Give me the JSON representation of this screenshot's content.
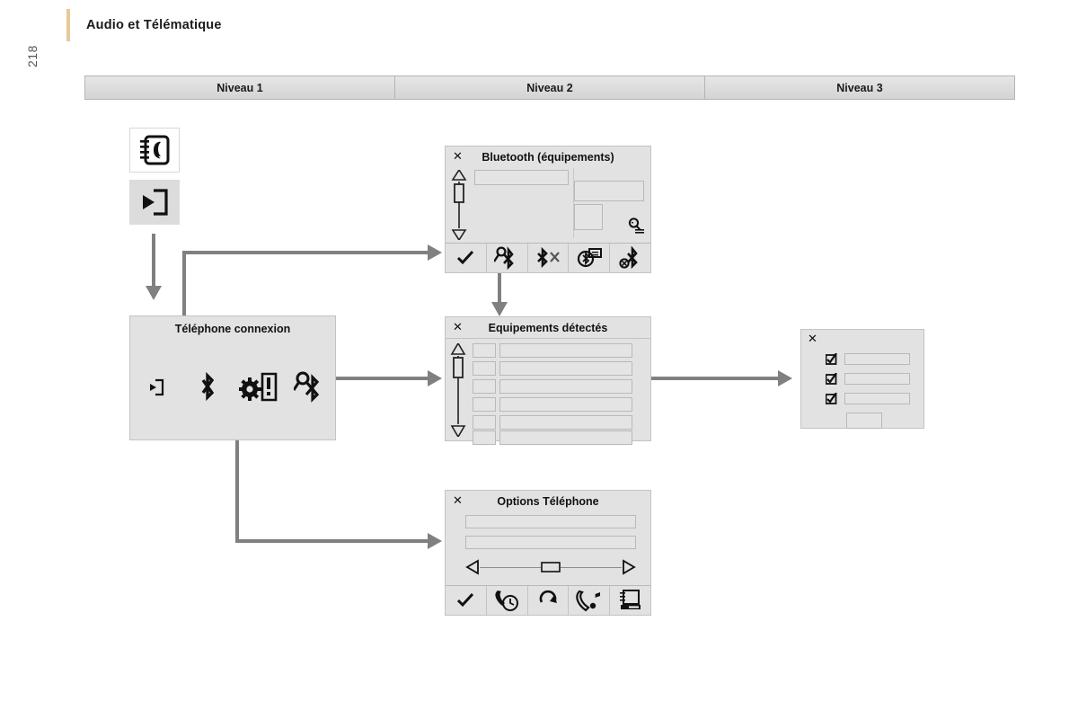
{
  "document": {
    "title": "Audio et Télématique",
    "page_number": "218"
  },
  "levels": {
    "columns": [
      {
        "label": "Niveau 1"
      },
      {
        "label": "Niveau 2"
      },
      {
        "label": "Niveau 3"
      }
    ]
  },
  "level1": {
    "tiles": [
      {
        "name": "phone-directory-icon",
        "icon": "phonebook-icon"
      },
      {
        "name": "enter-menu-icon",
        "icon": "enter-arrow-icon"
      }
    ],
    "phone_connection_panel": {
      "title": "Téléphone connexion",
      "icons": [
        {
          "name": "enter-arrow-icon",
          "icon": "enter-arrow-small-icon"
        },
        {
          "name": "bluetooth-icon",
          "icon": "bluetooth-icon"
        },
        {
          "name": "phone-settings-icon",
          "icon": "gear-phone-alert-icon"
        },
        {
          "name": "bluetooth-search-icon",
          "icon": "bluetooth-key-icon"
        }
      ]
    }
  },
  "level2": {
    "bluetooth_dialog": {
      "title": "Bluetooth (équipements)",
      "close_label": "✕",
      "scrollbar": {
        "name": "vertical-scrollbar"
      },
      "fields": [
        {
          "name": "device-name-field"
        },
        {
          "name": "device-info-field"
        },
        {
          "name": "device-thumbnail-field"
        }
      ],
      "search_icon": "magnifier-list-icon",
      "toolbar": [
        {
          "name": "confirm-button",
          "icon": "checkmark-icon"
        },
        {
          "name": "bluetooth-pair-button",
          "icon": "bluetooth-key-icon"
        },
        {
          "name": "bluetooth-disconnect-button",
          "icon": "bluetooth-x-icon"
        },
        {
          "name": "bluetooth-settings-button",
          "icon": "bluetooth-card-icon"
        },
        {
          "name": "bluetooth-delete-button",
          "icon": "bluetooth-remove-icon"
        }
      ]
    },
    "detected_devices_dialog": {
      "title": "Equipements détectés",
      "close_label": "✕",
      "scrollbar": {
        "name": "vertical-scrollbar"
      },
      "rows": [
        {
          "name": "device-row-1"
        },
        {
          "name": "device-row-2"
        },
        {
          "name": "device-row-3"
        },
        {
          "name": "device-row-4"
        },
        {
          "name": "device-row-5"
        },
        {
          "name": "device-row-6"
        }
      ]
    },
    "phone_options_dialog": {
      "title": "Options Téléphone",
      "close_label": "✕",
      "fields": [
        {
          "name": "option-field-1"
        },
        {
          "name": "option-field-2"
        }
      ],
      "slider": {
        "name": "volume-slider"
      },
      "toolbar": [
        {
          "name": "confirm-button",
          "icon": "checkmark-icon"
        },
        {
          "name": "call-duration-button",
          "icon": "phone-clock-icon"
        },
        {
          "name": "reset-button",
          "icon": "refresh-arrow-icon"
        },
        {
          "name": "ringtone-button",
          "icon": "phone-music-icon"
        },
        {
          "name": "contacts-button",
          "icon": "phonebook-stack-icon"
        }
      ]
    }
  },
  "level3": {
    "confirm_dialog": {
      "close_label": "✕",
      "rows": [
        {
          "name": "checkbox-row-1"
        },
        {
          "name": "checkbox-row-2"
        },
        {
          "name": "checkbox-row-3"
        }
      ],
      "button": {
        "name": "ok-button"
      }
    }
  },
  "colors": {
    "panel_bg": "#e2e2e2",
    "panel_border": "#c3c3c3",
    "connector": "#808080",
    "accent": "#e8c99a",
    "header_bg": "#dcdcdc",
    "ink": "#1a1a1a"
  }
}
